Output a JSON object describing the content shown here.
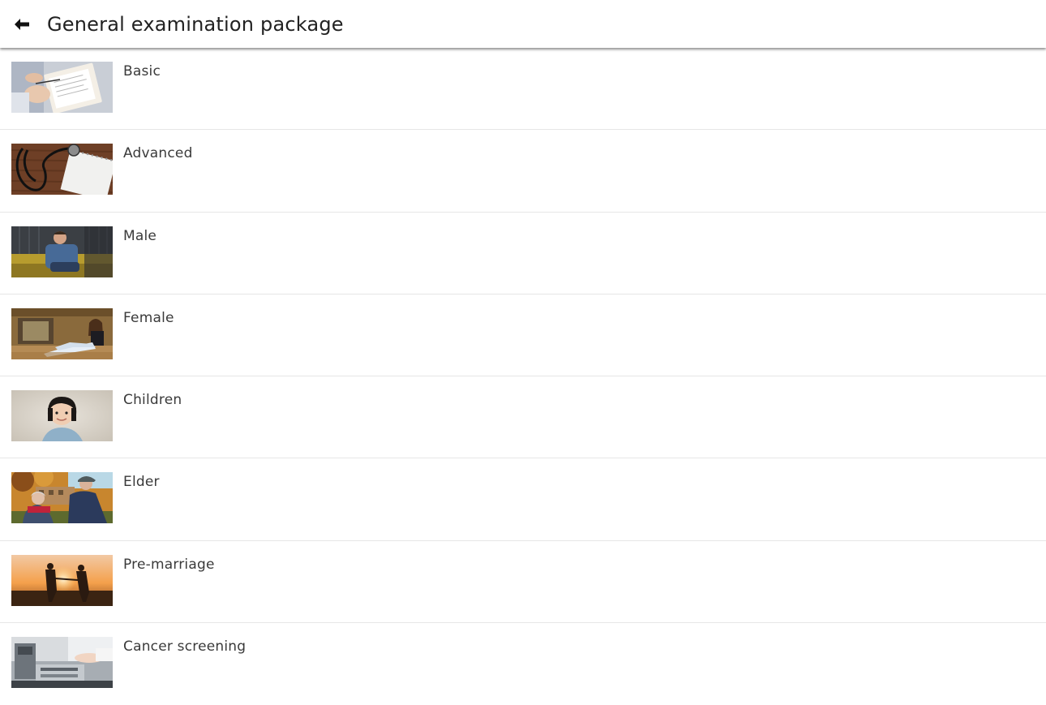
{
  "header": {
    "back_icon": "arrow-left-icon",
    "title": "General examination package"
  },
  "packages": [
    {
      "label": "Basic",
      "thumbnail": "doctor-clipboard-photo"
    },
    {
      "label": "Advanced",
      "thumbnail": "stethoscope-notepad-photo"
    },
    {
      "label": "Male",
      "thumbnail": "man-on-sofa-photo"
    },
    {
      "label": "Female",
      "thumbnail": "woman-sitting-photo"
    },
    {
      "label": "Children",
      "thumbnail": "child-portrait-photo"
    },
    {
      "label": "Elder",
      "thumbnail": "elderly-couple-photo"
    },
    {
      "label": "Pre-marriage",
      "thumbnail": "couple-sunset-photo"
    },
    {
      "label": "Cancer screening",
      "thumbnail": "lab-equipment-photo"
    }
  ]
}
